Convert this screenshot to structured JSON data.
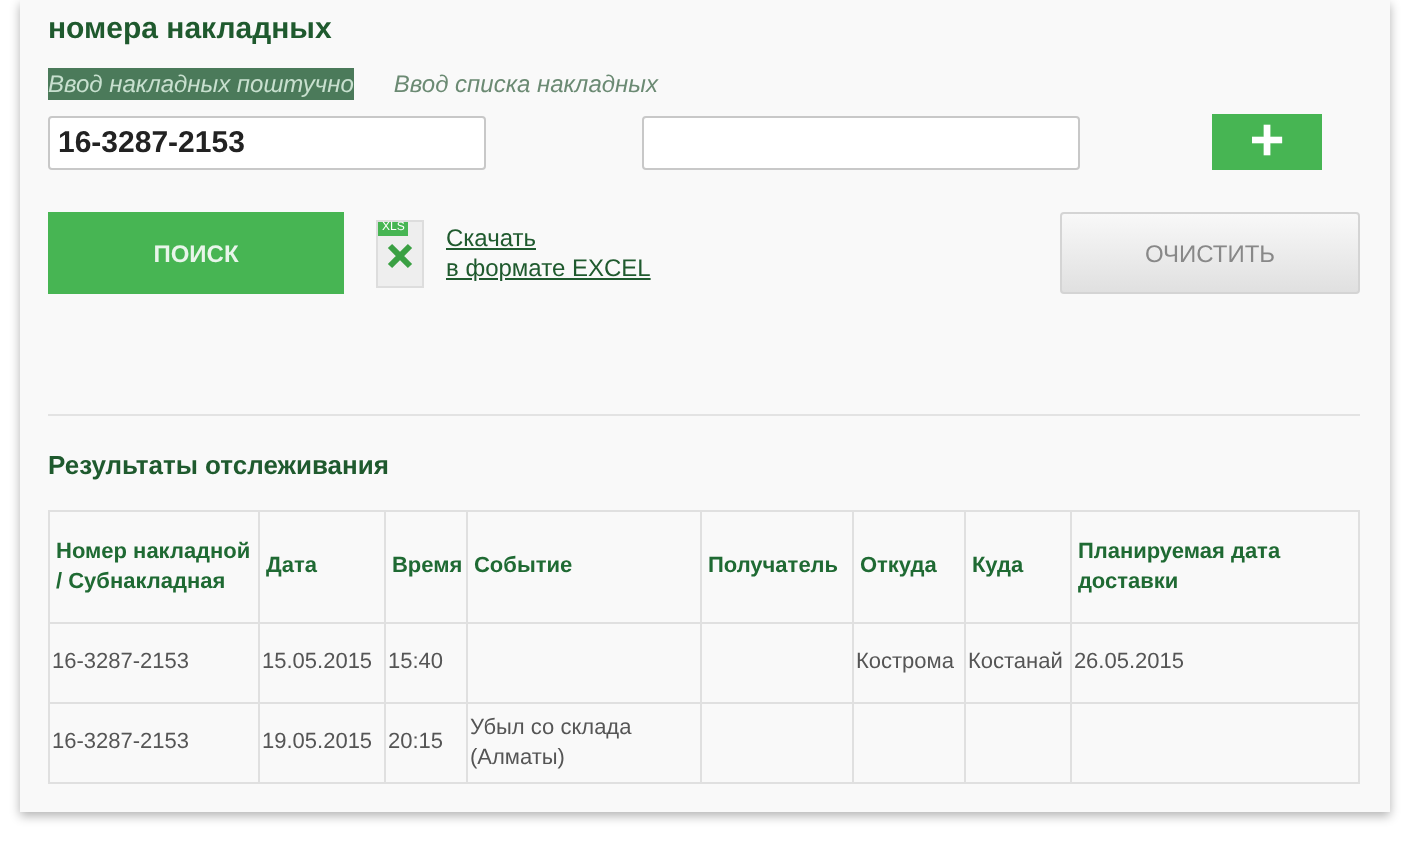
{
  "heading": "номера накладных",
  "tabs": [
    {
      "label": "Ввод накладных поштучно",
      "selected": true
    },
    {
      "label": "Ввод списка накладных",
      "selected": false
    }
  ],
  "inputs": [
    {
      "value": "16-3287-2153"
    }
  ],
  "add_button": {
    "label": "+"
  },
  "search_button": {
    "label": "ПОИСК"
  },
  "excel_link": {
    "icon_label": "XLS",
    "line_1": "Скачать",
    "line_2": "в формате EXCEL"
  },
  "clear_button": {
    "label": "ОЧИСТИТЬ"
  },
  "results": {
    "title": "Результаты отслеживания",
    "columns": [
      "Номер накладной / Субнакладная",
      "Дата",
      "Время",
      "Событие",
      "Получатель",
      "Откуда",
      "Куда",
      "Планируемая дата доставки"
    ],
    "rows": [
      [
        "16-3287-2153",
        "15.05.2015",
        "15:40",
        null,
        null,
        "Кострома",
        "Костанай",
        "26.05.2015"
      ],
      [
        "16-3287-2153",
        "19.05.2015",
        "20:15",
        "Убыл со склада (Алматы)",
        null,
        null,
        null,
        null
      ]
    ]
  }
}
